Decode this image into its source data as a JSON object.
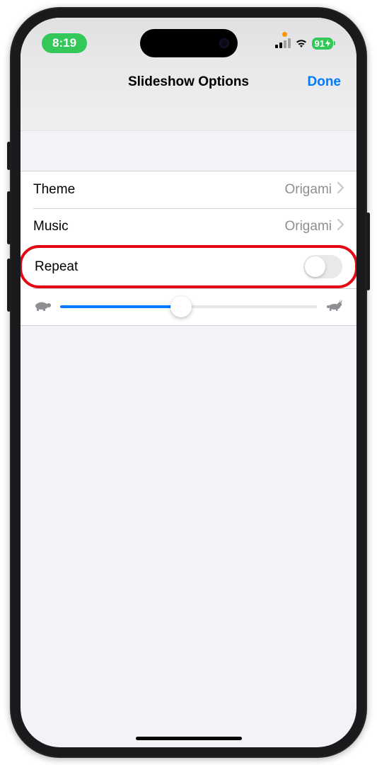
{
  "status": {
    "time": "8:19",
    "battery": "91"
  },
  "nav": {
    "title": "Slideshow Options",
    "done": "Done"
  },
  "rows": {
    "theme": {
      "label": "Theme",
      "value": "Origami"
    },
    "music": {
      "label": "Music",
      "value": "Origami"
    },
    "repeat": {
      "label": "Repeat",
      "on": false
    }
  },
  "slider": {
    "position_percent": 47
  }
}
